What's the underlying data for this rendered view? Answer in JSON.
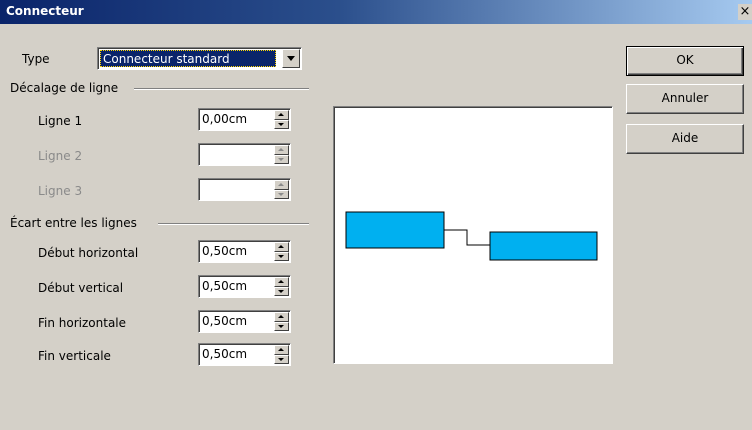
{
  "window": {
    "title": "Connecteur",
    "close_glyph": "×"
  },
  "type_row": {
    "label": "Type",
    "selected": "Connecteur standard"
  },
  "line_offset": {
    "heading": "Décalage de ligne",
    "rows": [
      {
        "label": "Ligne 1",
        "value": "0,00cm",
        "enabled": true
      },
      {
        "label": "Ligne 2",
        "value": "",
        "enabled": false
      },
      {
        "label": "Ligne 3",
        "value": "",
        "enabled": false
      }
    ]
  },
  "line_spacing": {
    "heading": "Écart entre les lignes",
    "rows": [
      {
        "label": "Début horizontal",
        "value": "0,50cm"
      },
      {
        "label": "Début vertical",
        "value": "0,50cm"
      },
      {
        "label": "Fin horizontale",
        "value": "0,50cm"
      },
      {
        "label": "Fin verticale",
        "value": "0,50cm"
      }
    ]
  },
  "buttons": {
    "ok": "OK",
    "cancel": "Annuler",
    "help": "Aide"
  },
  "preview": {
    "box_color": "#00b0f0",
    "line_color": "#000000"
  },
  "colors": {
    "face": "#d4d0c8",
    "selection": "#0a246a"
  }
}
